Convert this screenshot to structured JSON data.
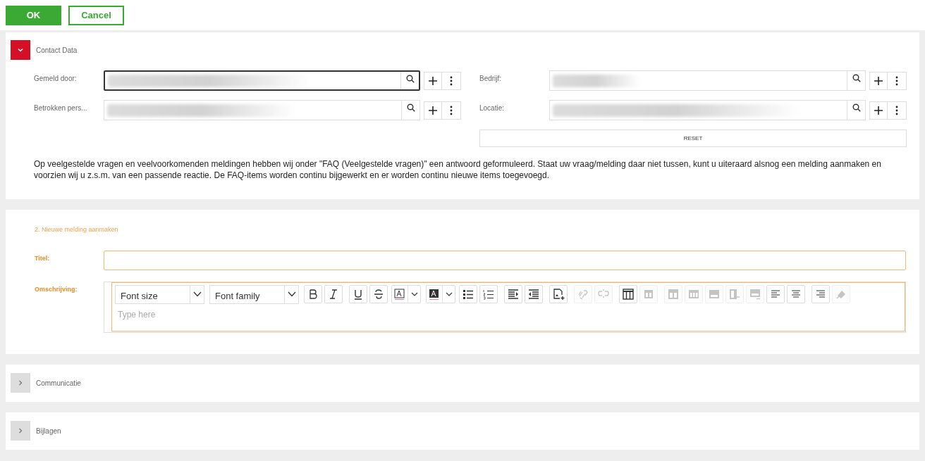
{
  "actions": [
    {
      "label": "OK",
      "kind": "primary"
    },
    {
      "label": "Cancel",
      "kind": "secondary"
    }
  ],
  "sections": [
    {
      "kind": "contact",
      "title": "Contact Data",
      "expanded": true,
      "fields": [
        {
          "label": "Gemeld door:",
          "focused": true,
          "redacted": true
        },
        {
          "label": "Bedrijf:",
          "focused": false,
          "redacted": true
        },
        {
          "label": "Betrokken pers...",
          "focused": false,
          "redacted": true
        },
        {
          "label": "Locatie:",
          "focused": false,
          "redacted": true
        }
      ],
      "reset": "RESET",
      "note": "Op veelgestelde vragen en veelvoorkomenden meldingen hebben wij onder \"FAQ (Veelgestelde vragen)\" een antwoord geformuleerd. Staat uw vraag/melding daar niet tussen, kunt u uiteraard alsnog een melding aanmaken en voorzien wij u z.s.m. van een passende reactie. De FAQ-items worden continu bijgewerkt en er worden continu nieuwe items toegevoegd."
    },
    {
      "kind": "form",
      "title": "2. Nieuwe melding aanmaken",
      "title_label": "Titel:",
      "description_label": "Omschrijving:",
      "placeholder": "Type here",
      "toolbar": [
        {
          "kind": "select",
          "label": "Font size"
        },
        {
          "kind": "select",
          "label": "Font family"
        },
        {
          "kind": "button",
          "disabled": false
        },
        {
          "kind": "button",
          "disabled": false
        },
        {
          "kind": "button",
          "disabled": false
        },
        {
          "kind": "button",
          "disabled": false
        },
        {
          "kind": "split",
          "disabled": false
        },
        {
          "kind": "split",
          "disabled": false
        },
        {
          "kind": "button",
          "disabled": false
        },
        {
          "kind": "button",
          "disabled": false
        },
        {
          "kind": "button",
          "disabled": false
        },
        {
          "kind": "button",
          "disabled": false
        },
        {
          "kind": "button",
          "disabled": false
        },
        {
          "kind": "button",
          "disabled": true
        },
        {
          "kind": "button",
          "disabled": true
        },
        {
          "kind": "button",
          "disabled": false
        },
        {
          "kind": "button",
          "disabled": true
        },
        {
          "kind": "button",
          "disabled": true
        },
        {
          "kind": "button",
          "disabled": true
        },
        {
          "kind": "button",
          "disabled": true
        },
        {
          "kind": "button",
          "disabled": true
        },
        {
          "kind": "button",
          "disabled": true
        },
        {
          "kind": "button",
          "disabled": false
        },
        {
          "kind": "button",
          "disabled": false
        },
        {
          "kind": "button",
          "disabled": false
        },
        {
          "kind": "button",
          "disabled": true
        }
      ]
    },
    {
      "kind": "collapsed",
      "title": "Communicatie",
      "expanded": false
    },
    {
      "kind": "collapsed",
      "title": "Bijlagen",
      "expanded": false
    }
  ]
}
